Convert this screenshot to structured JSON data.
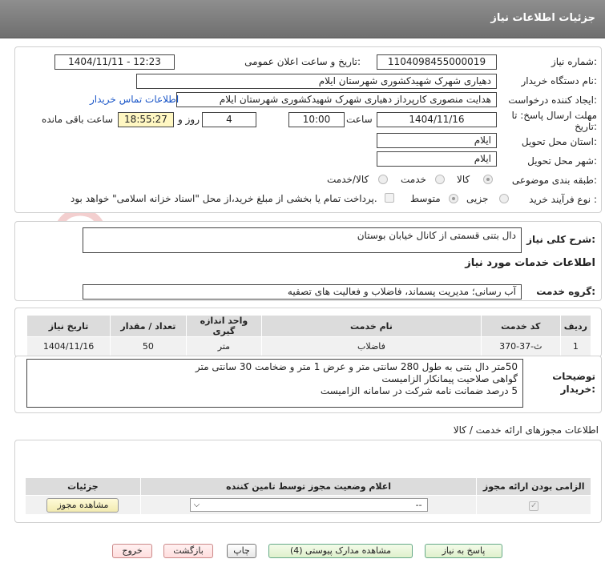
{
  "header": {
    "title": "جزئیات اطلاعات نیاز"
  },
  "form": {
    "need_number_label": "شماره نیاز:",
    "need_number": "1104098455000019",
    "announce_label": "تاریخ و ساعت اعلان عمومی:",
    "announce_value": "1404/11/11 - 12:23",
    "buyer_org_label": "نام دستگاه خریدار:",
    "buyer_org": "دهیاری شهرک شهیدکشوری شهرستان ایلام",
    "creator_label": "ایجاد کننده درخواست:",
    "creator": "هدایت منصوری کارپرداز دهیاری شهرک شهیدکشوری شهرستان ایلام",
    "contact_link": "اطلاعات تماس خریدار",
    "deadline_label_1": "مهلت ارسال پاسخ: تا",
    "deadline_label_2": "تاریخ:",
    "deadline_date": "1404/11/16",
    "time_label": "ساعت",
    "deadline_time": "10:00",
    "days_value": "4",
    "days_label": "روز و",
    "remaining_time": "18:55:27",
    "remaining_label": "ساعت باقی مانده",
    "province_label": "استان محل تحویل:",
    "province": "ایلام",
    "city_label": "شهر محل تحویل:",
    "city": "ایلام",
    "category_label": "طبقه بندی موضوعی:",
    "category_options": [
      "کالا",
      "خدمت",
      "کالا/خدمت"
    ],
    "process_label": "نوع فرآیند خرید :",
    "process_options": [
      "جزیی",
      "متوسط"
    ],
    "payment_note": "پرداخت تمام یا بخشی از مبلغ خرید،از محل \"اسناد خزانه اسلامی\" خواهد بود."
  },
  "need": {
    "summary_label": "شرح کلی نیاز:",
    "summary": "دال بتنی قسمتی از کانال خیابان بوستان",
    "services_title": "اطلاعات خدمات مورد نیاز",
    "service_group_label": "گروه خدمت:",
    "service_group": "آب رسانی؛ مدیریت پسماند، فاضلاب و فعالیت های تصفیه"
  },
  "services_table": {
    "headers": [
      "ردیف",
      "کد خدمت",
      "نام خدمت",
      "واحد اندازه گیری",
      "تعداد / مقدار",
      "تاریخ نیاز"
    ],
    "rows": [
      [
        "1",
        "ث-37-370",
        "فاضلاب",
        "متر",
        "50",
        "1404/11/16"
      ]
    ]
  },
  "buyer_notes": {
    "label_1": "توضیحات",
    "label_2": "خریدار:",
    "text": "50متر دال بتنی به طول 280 سانتی متر و عرض 1 متر و ضخامت 30 سانتی متر\nگواهی صلاحیت پیمانکار الزامیست\n5 درصد ضمانت نامه شرکت در سامانه الزامیست"
  },
  "permits": {
    "title": "اطلاعات مجوزهای ارائه خدمت / کالا",
    "headers": [
      "الزامی بودن ارائه مجوز",
      "اعلام وضعیت مجوز توسط تامین کننده",
      "جزئیات"
    ],
    "select_value": "--",
    "view_button": "مشاهده مجوز"
  },
  "actions": {
    "reply": "پاسخ به نیاز",
    "attachments": "مشاهده مدارک پیوستی (4)",
    "print": "چاپ",
    "back": "بازگشت",
    "exit": "خروج"
  },
  "watermark": {
    "text": "AriaTender.neT"
  },
  "colors": {
    "header": "#7f7f7f",
    "link": "#1a56c8",
    "yellow": "#fff7c2",
    "watermark": "#e3a3a3"
  }
}
